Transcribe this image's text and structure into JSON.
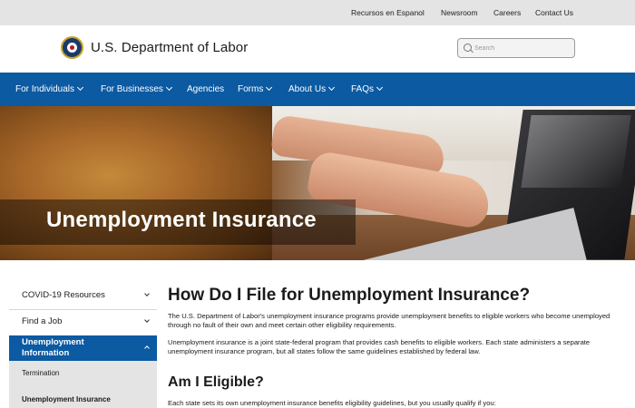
{
  "utility_bar": {
    "links": [
      "Recursos en Espanol",
      "Newsroom",
      "Careers",
      "Contact Us"
    ]
  },
  "header": {
    "title": "U.S. Department of Labor",
    "search_placeholder": "Search"
  },
  "nav": {
    "items": [
      {
        "label": "For Individuals",
        "has_dropdown": true
      },
      {
        "label": "For Businesses",
        "has_dropdown": true
      },
      {
        "label": "Agencies",
        "has_dropdown": false
      },
      {
        "label": "Forms",
        "has_dropdown": true
      },
      {
        "label": "About Us",
        "has_dropdown": true
      },
      {
        "label": "FAQs",
        "has_dropdown": true
      }
    ]
  },
  "hero": {
    "title": "Unemployment Insurance"
  },
  "sidebar": {
    "items": [
      {
        "label": "COVID-19 Resources"
      },
      {
        "label": "Find a Job"
      }
    ],
    "active": {
      "label": "Unemployment Information"
    },
    "subitems": [
      "Termination",
      "Unemployment Insurance"
    ]
  },
  "main": {
    "title": "How Do I File for Unemployment Insurance?",
    "paragraphs": [
      "The U.S. Department of Labor's unemployment insurance programs provide unemployment benefits to eligible workers who become unemployed through no fault of their own and meet certain other eligibility requirements.",
      "Unemployment insurance is a joint state-federal program that provides cash benefits to eligible workers. Each state administers a separate unemployment insurance program, but all states follow the same guidelines established by federal law."
    ],
    "subheading": "Am I Eligible?",
    "eligibility_text": "Each state sets its own unemployment insurance benefits eligibility guidelines, but you usually qualify if you:"
  },
  "colors": {
    "nav_blue": "#0b5aa2",
    "utility_gray": "#e4e4e4"
  }
}
